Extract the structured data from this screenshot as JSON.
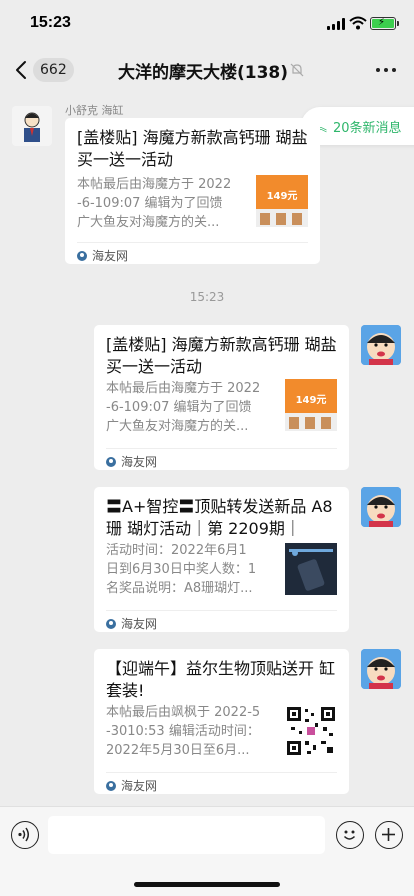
{
  "status": {
    "time": "15:23"
  },
  "nav": {
    "back_count": "662",
    "title": "大洋的摩天大楼(138)"
  },
  "new_messages": {
    "label": "20条新消息"
  },
  "sender": {
    "name": "小舒克 海缸"
  },
  "timestamp": "15:23",
  "messages": [
    {
      "title": "[盖楼贴] 海魔方新款高钙珊 瑚盐买一送一活动",
      "desc": "本帖最后由海魔方于 2022\n-6-109:07 编辑为了回馈\n广大鱼友对海魔方的关...",
      "source": "海友网",
      "thumb_text": "149元"
    },
    {
      "title": "[盖楼贴] 海魔方新款高钙珊 瑚盐买一送一活动",
      "desc": "本帖最后由海魔方于 2022\n-6-109:07 编辑为了回馈\n广大鱼友对海魔方的关...",
      "source": "海友网",
      "thumb_text": "149元"
    },
    {
      "title": "〓A+智控〓顶贴转发送新品 A8珊 瑚灯活动｜第 2209期｜",
      "desc": "活动时间：2022年6月1\n日到6月30日中奖人数：1\n名奖品说明：A8珊瑚灯...",
      "source": "海友网"
    },
    {
      "title": "【迎端午】益尔生物顶贴送开 缸套装!",
      "desc": "本帖最后由飒枫于 2022-5\n-3010:53 编辑活动时间：\n2022年5月30日至6月...",
      "source": "海友网"
    }
  ],
  "input": {
    "placeholder": ""
  },
  "colors": {
    "accent_green": "#2fb66b",
    "background": "#ededed",
    "battery": "#3ccf4e"
  }
}
